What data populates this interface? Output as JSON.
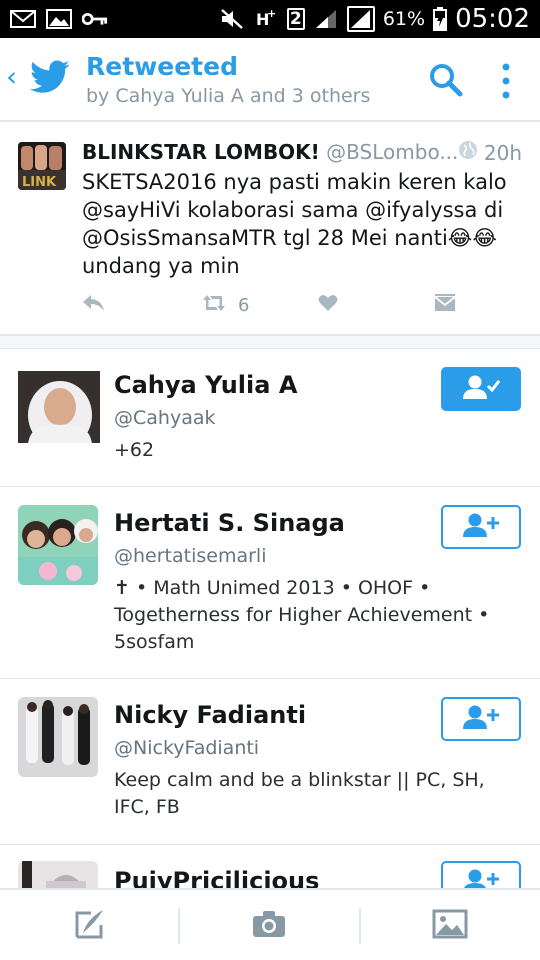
{
  "status_bar": {
    "network_label": "2",
    "battery": "61%",
    "time": "05:02",
    "icons": [
      "mail-icon",
      "gallery-icon",
      "key-icon",
      "mute-icon",
      "hplus-icon",
      "signal-icon",
      "signal-icon",
      "battery-icon"
    ]
  },
  "header": {
    "title": "Retweeted",
    "subtitle": "by Cahya Yulia A and 3 others",
    "accent_color": "#2b9de8"
  },
  "tweet": {
    "name": "BLINKSTAR LOMBOK!",
    "handle": "@BSLombo...",
    "time": "20h",
    "text": "SKETSA2016 nya pasti makin keren kalo @sayHiVi kolaborasi sama @ifyalyssa di @OsisSmansaMTR tgl 28 Mei nanti😂😂 undang ya min",
    "retweet_count": "6"
  },
  "users": [
    {
      "name": "Cahya Yulia A",
      "handle": "@Cahyaak",
      "bio": "+62",
      "following": true
    },
    {
      "name": "Hertati S. Sinaga",
      "handle": "@hertatisemarli",
      "bio": "✝ • Math Unimed 2013 • OHOF • Togetherness for Higher Achievement • 5sosfam",
      "following": false
    },
    {
      "name": "Nicky Fadianti",
      "handle": "@NickyFadianti",
      "bio": "Keep calm and be a blinkstar || PC, SH, IFC, FB",
      "following": false
    },
    {
      "name": "PujyPricilicious",
      "handle": "",
      "bio": "",
      "following": false
    }
  ],
  "bottom_bar": {
    "items": [
      "compose-icon",
      "camera-icon",
      "image-icon"
    ]
  }
}
